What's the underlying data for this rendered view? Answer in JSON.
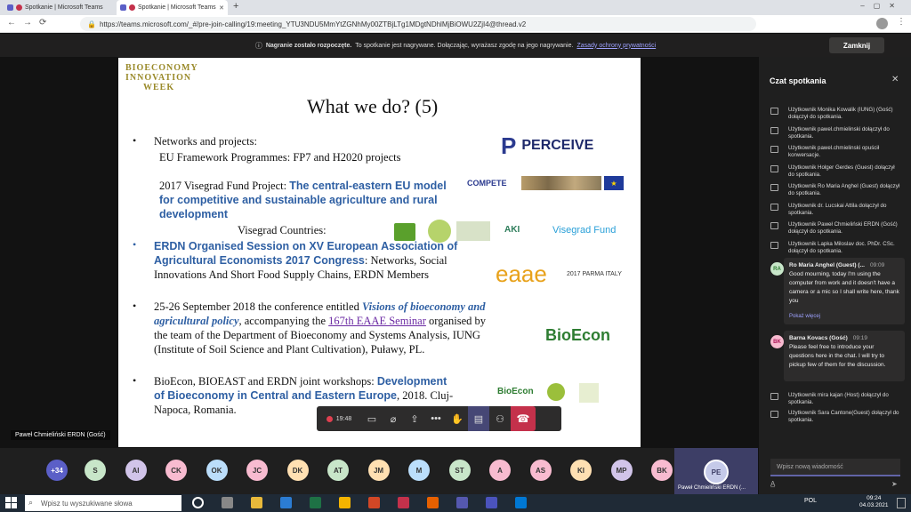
{
  "browser": {
    "tabs": [
      {
        "label": "Spotkanie | Microsoft Teams"
      },
      {
        "label": "Spotkanie | Microsoft Teams"
      }
    ],
    "url": "https://teams.microsoft.com/_#/pre-join-calling/19:meeting_YTU3NDU5MmYtZGNhMy00ZTBjLTg1MDgtNDhlMjBiOWU2ZjI4@thread.v2"
  },
  "banner": {
    "bold": "Nagranie zostało rozpoczęte.",
    "text": "To spotkanie jest nagrywane. Dołączając, wyrażasz zgodę na jego nagrywanie.",
    "link": "Zasady ochrony prywatności",
    "close_label": "Zamknij"
  },
  "slide": {
    "logo_line1": "BIOECONOMY",
    "logo_line2": "INNOVATION",
    "logo_line3": "WEEK",
    "title": "What we do? (5)",
    "b1": "Networks and projects:",
    "b1_sub": "EU Framework Programmes: FP7 and H2020 projects",
    "visegrad_plain": "2017 Visegrad Fund Project: ",
    "visegrad_blue": "The central-eastern EU model for competitive and sustainable agriculture and rural development",
    "visegrad_countries": "Visegrad Countries:",
    "b2_blue": "ERDN Organised Session on XV European Association of Agricultural Economists 2017 Congress",
    "b2_plain": ": Networks, Social Innovations And Short Food Supply Chains, ERDN Members",
    "b3_a": "25-26 September 2018 the conference entitled ",
    "b3_ital": "Visions of bioeconomy and agricultural policy",
    "b3_b": ", accompanying the ",
    "b3_link": "167th EAAE Seminar",
    "b3_c": " organised by the team of the Department of  Bioeconomy and Systems Analysis, IUNG (Institute of Soil Science and Plant Cultivation), Puławy, PL.",
    "b4_a": "BioEcon, BIOEAST and ERDN joint workshops: ",
    "b4_blue": "Development of Bioeconomy in Central and Eastern Europe",
    "b4_b": ", 2018. Cluj-Napoca, Romania.",
    "perceive": "PERCEIVE",
    "compete": "COMPETE",
    "visegrad_fund": "Visegrad Fund",
    "aki": "AKI",
    "eaae": "eaae",
    "eaae_sub": "2017 PARMA ITALY",
    "bioecon": "BioEcon",
    "bioecon_small": "BioEcon"
  },
  "speaker": "Paweł Chmieliński ERDN (Gość)",
  "controls": {
    "timer": "19:48"
  },
  "participants": {
    "more": "+34",
    "initials": [
      "S",
      "AI",
      "CK",
      "OK",
      "JC",
      "DK",
      "AT",
      "JM",
      "M",
      "ST",
      "A",
      "AS",
      "KI",
      "MP",
      "BK"
    ],
    "colors": [
      "#c8e6c9",
      "#d1c4e9",
      "#f8bbd0",
      "#bbdefb",
      "#f8bbd0",
      "#ffe0b2",
      "#c8e6c9",
      "#ffe0b2",
      "#bbdefb",
      "#c8e6c9",
      "#f8bbd0",
      "#f8bbd0",
      "#ffe0b2",
      "#d1c4e9",
      "#f8bbd0"
    ],
    "self_initials": "PE",
    "self_name": "Paweł Chmieliński ERDN (..."
  },
  "chat": {
    "title": "Czat spotkania",
    "events": [
      "Użytkownik Monika Kowalik (IUNG) (Gość) dołączył do spotkania.",
      "Użytkownik pawel.chmielinski dołączył do spotkania.",
      "Użytkownik pawel.chmielinski opuścił konwersacje.",
      "Użytkownik Holger Gerdes (Guest) dołączył do spotkania.",
      "Użytkownik Ro Maria Anghel (Guest) dołączył do spotkania.",
      "Użytkownik dr. Lucskai Attila dołączył do spotkania.",
      "Użytkownik Paweł Chmieliński ERDN (Gość) dołączył do spotkania.",
      "Użytkownik Lapka Miloslav doc. PhDr. CSc. dołączył do spotkania."
    ],
    "msg1": {
      "avatar": "RA",
      "author": "Ro Maria Anghel (Guest) (...",
      "time": "09:09",
      "text": "Good mourning, today I'm using the computer from work and it doesn't have a camera or a mic so I shall write here, thank you",
      "more": "Pokaż więcej"
    },
    "msg2": {
      "avatar": "BK",
      "author": "Barna Kovacs (Gość)",
      "time": "09:19",
      "text": "Please feel free to introduce your questions here in the chat. I will try to pickup few of them for the discussion."
    },
    "events2": [
      "Użytkownik mira kajan (Host) dołączył do spotkania.",
      "Użytkownik Sara Cantone(Guest) dołączył do spotkania."
    ],
    "compose_placeholder": "Wpisz nową wiadomość"
  },
  "taskbar": {
    "search_placeholder": "Wpisz tu wyszukiwane słowa",
    "lang": "POL",
    "time": "09:24",
    "date": "04.03.2021"
  }
}
